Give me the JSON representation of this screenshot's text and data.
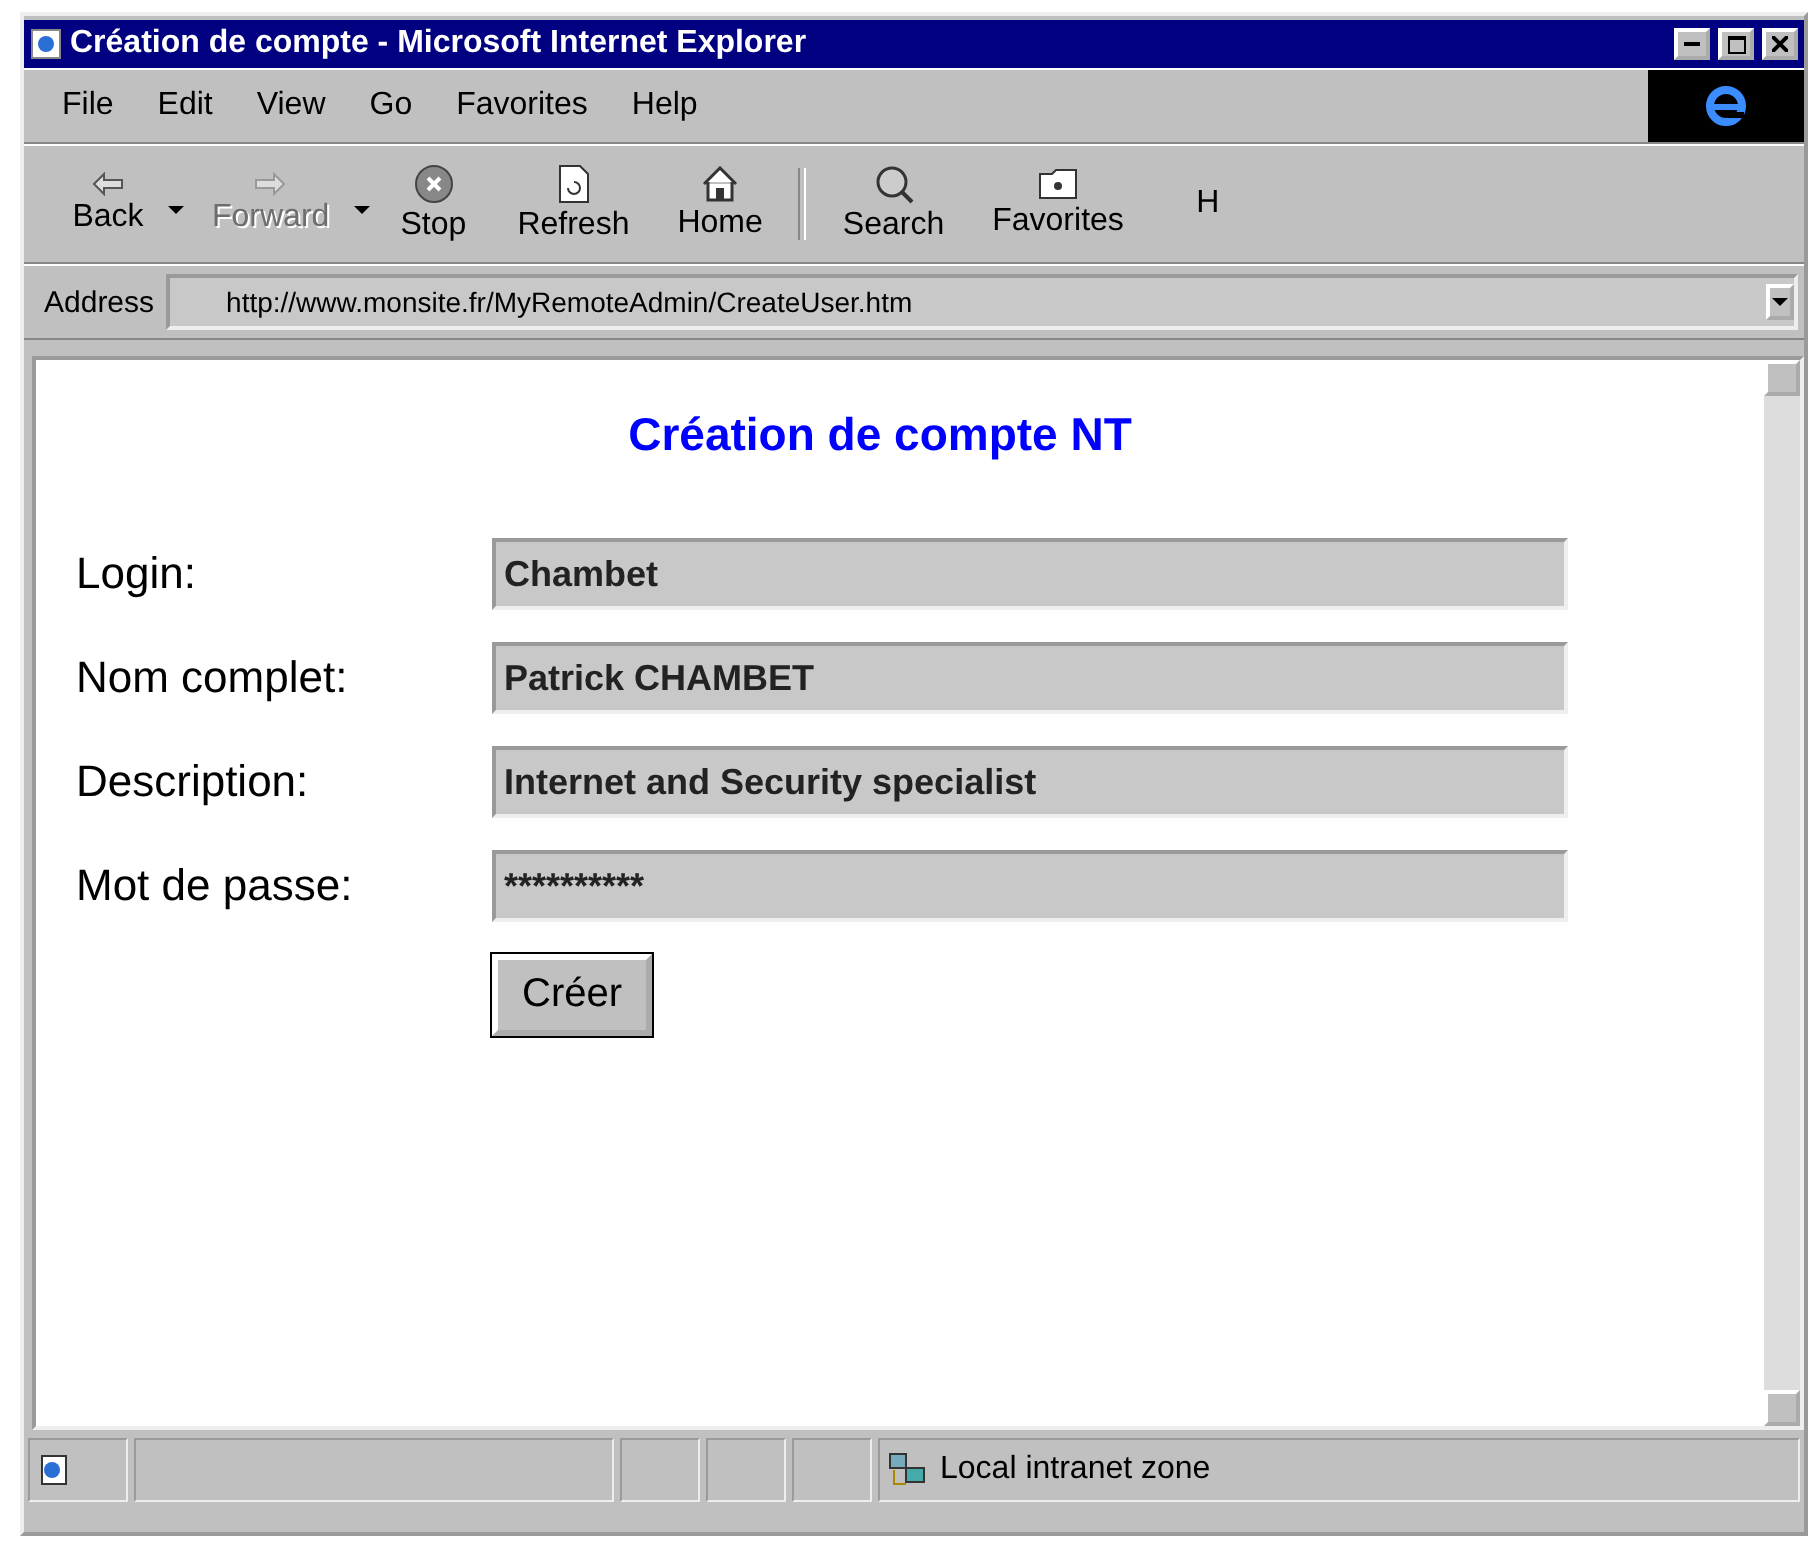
{
  "window": {
    "title": "Création de compte - Microsoft Internet Explorer"
  },
  "menu": [
    "File",
    "Edit",
    "View",
    "Go",
    "Favorites",
    "Help"
  ],
  "toolbar": [
    {
      "label": "Back",
      "kind": "back",
      "disabled": false,
      "has_menu": true
    },
    {
      "label": "Forward",
      "kind": "forward",
      "disabled": true,
      "has_menu": true
    },
    {
      "label": "Stop",
      "kind": "stop",
      "disabled": false,
      "has_menu": false
    },
    {
      "label": "Refresh",
      "kind": "refresh",
      "disabled": false,
      "has_menu": false
    },
    {
      "label": "Home",
      "kind": "home",
      "disabled": false,
      "has_menu": false
    },
    {
      "label": "Search",
      "kind": "search",
      "disabled": false,
      "has_menu": false
    },
    {
      "label": "Favorites",
      "kind": "favorites",
      "disabled": false,
      "has_menu": false
    },
    {
      "label": "H",
      "kind": "cut",
      "disabled": false,
      "has_menu": false
    }
  ],
  "address": {
    "label": "Address",
    "value": "http://www.monsite.fr/MyRemoteAdmin/CreateUser.htm"
  },
  "page": {
    "heading": "Création de compte NT",
    "fields": [
      {
        "label": "Login:",
        "value": "Chambet"
      },
      {
        "label": "Nom complet:",
        "value": "Patrick CHAMBET"
      },
      {
        "label": "Description:",
        "value": "Internet and Security specialist"
      },
      {
        "label": "Mot de passe:",
        "value": "**********"
      }
    ],
    "button": "Créer"
  },
  "status_bar": {
    "zone": "Local intranet zone"
  }
}
